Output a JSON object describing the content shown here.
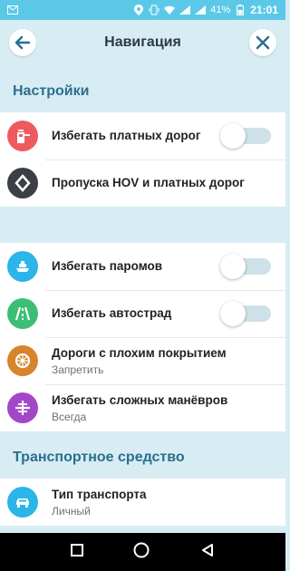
{
  "status_bar": {
    "battery": "41%",
    "time": "21:01"
  },
  "header": {
    "title": "Навигация"
  },
  "sections": {
    "settings_title": "Настройки",
    "vehicle_title": "Транспортное средство"
  },
  "rows": {
    "tolls": {
      "title": "Избегать платных дорог",
      "toggle": false
    },
    "hov": {
      "title": "Пропуска HOV и платных дорог"
    },
    "ferries": {
      "title": "Избегать паромов",
      "toggle": false
    },
    "freeways": {
      "title": "Избегать автострад",
      "toggle": false
    },
    "rough_roads": {
      "title": "Дороги с плохим покрытием",
      "value": "Запретить"
    },
    "difficult": {
      "title": "Избегать сложных манёвров",
      "value": "Всегда"
    },
    "vehicle_type": {
      "title": "Тип транспорта",
      "value": "Личный"
    }
  },
  "colors": {
    "tolls": "#ef5a5f",
    "hov": "#3c3f44",
    "ferries": "#2bb5e8",
    "freeways": "#3bbf77",
    "rough_roads": "#d8842b",
    "difficult": "#a347c9",
    "vehicle": "#2bb5e8"
  }
}
